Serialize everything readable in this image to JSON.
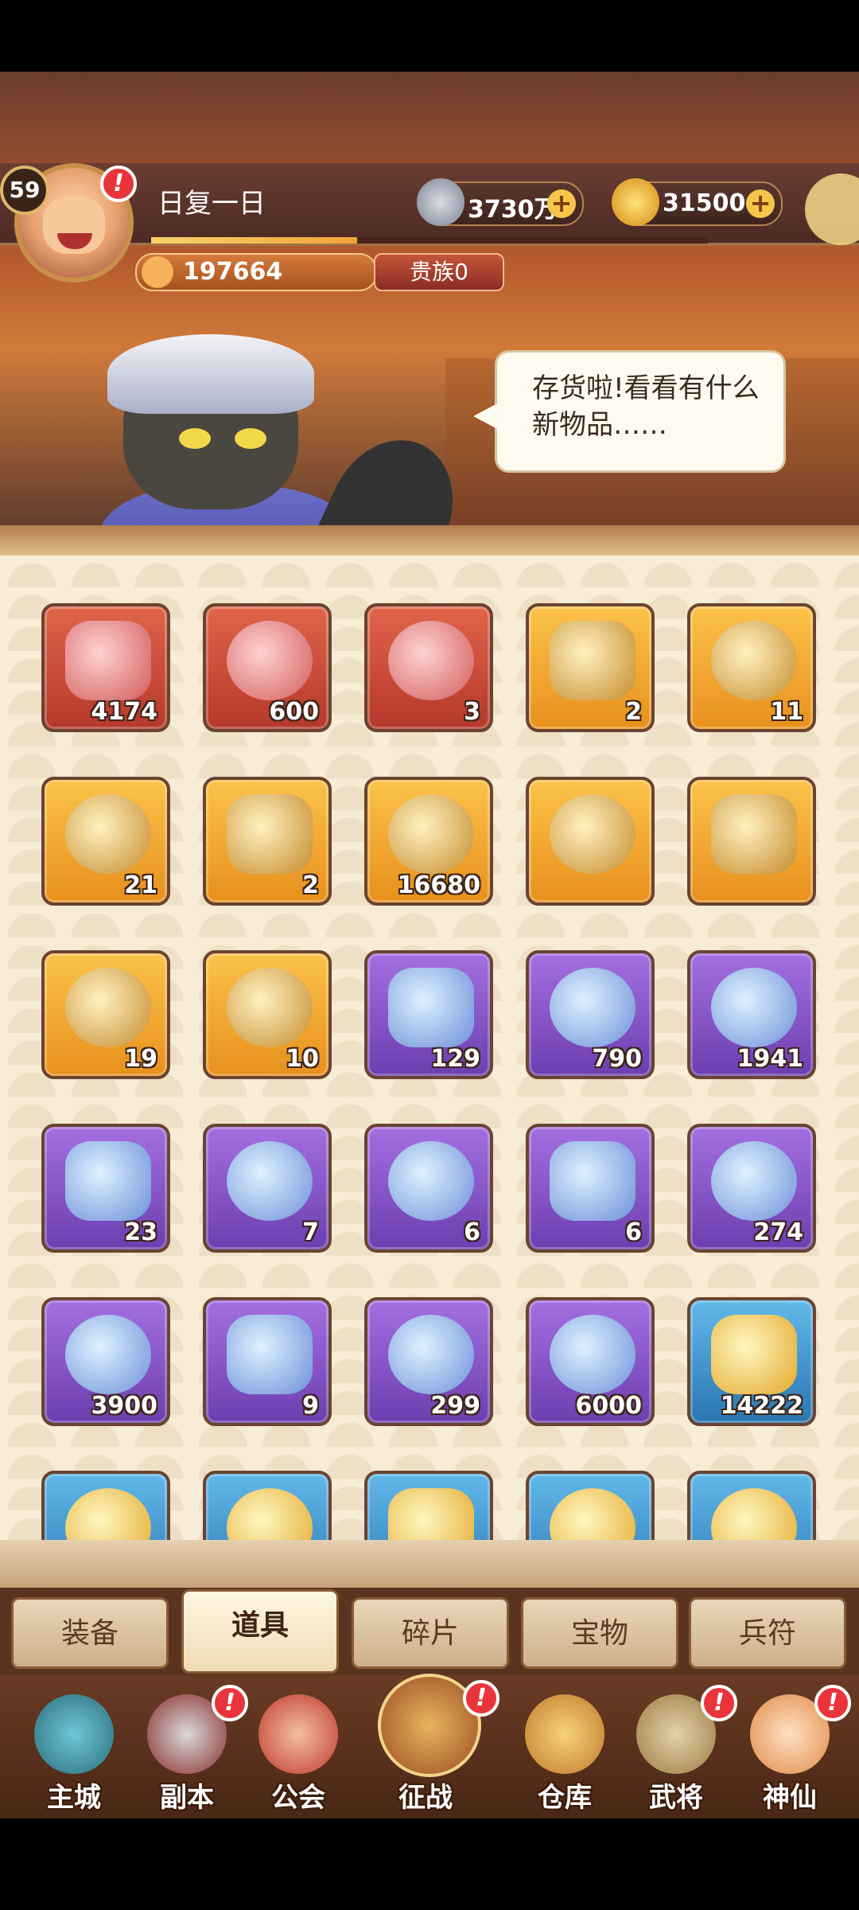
{
  "header": {
    "level": "59",
    "nickname": "日复一日",
    "power": "197664",
    "noble": "贵族0",
    "progress": 0.37,
    "alert_badge": "!",
    "speech": "存货啦!看看有什么新物品……",
    "currencies": [
      {
        "name": "silver-coin",
        "value": "3730万",
        "plus": "+"
      },
      {
        "name": "gold-ingot",
        "value": "31500",
        "plus": "+"
      }
    ]
  },
  "inventory": {
    "items": [
      {
        "name": "pink-crystal",
        "count": "4174",
        "rarity": "red"
      },
      {
        "name": "dark-crystal",
        "count": "600",
        "rarity": "red"
      },
      {
        "name": "jade-chest",
        "count": "3",
        "rarity": "red"
      },
      {
        "name": "bronze-beast",
        "count": "2",
        "rarity": "gold"
      },
      {
        "name": "rune-stone",
        "count": "11",
        "rarity": "gold"
      },
      {
        "name": "general-scroll",
        "count": "21",
        "rarity": "gold"
      },
      {
        "name": "white-lotus",
        "count": "2",
        "rarity": "gold"
      },
      {
        "name": "ore-stone",
        "count": "16680",
        "rarity": "gold"
      },
      {
        "name": "silver-bag",
        "count": "",
        "rarity": "gold"
      },
      {
        "name": "gem-gift-box",
        "count": "",
        "rarity": "gold"
      },
      {
        "name": "phoenix-orb",
        "count": "19",
        "rarity": "gold"
      },
      {
        "name": "flame-orb",
        "count": "10",
        "rarity": "gold"
      },
      {
        "name": "leaf-orb",
        "count": "129",
        "rarity": "purple"
      },
      {
        "name": "scroll",
        "count": "790",
        "rarity": "purple"
      },
      {
        "name": "blue-flame-orb",
        "count": "1941",
        "rarity": "purple"
      },
      {
        "name": "lotus",
        "count": "23",
        "rarity": "purple"
      },
      {
        "name": "gold-ticket",
        "count": "7",
        "rarity": "purple"
      },
      {
        "name": "silver-ingots",
        "count": "6",
        "rarity": "purple"
      },
      {
        "name": "gem-box",
        "count": "6",
        "rarity": "purple"
      },
      {
        "name": "gold-stone",
        "count": "274",
        "rarity": "purple"
      },
      {
        "name": "purple-gem",
        "count": "3900",
        "rarity": "purple"
      },
      {
        "name": "badge",
        "count": "9",
        "rarity": "purple"
      },
      {
        "name": "wooden-token",
        "count": "299",
        "rarity": "purple"
      },
      {
        "name": "gold-coin",
        "count": "6000",
        "rarity": "purple"
      },
      {
        "name": "purple-flame",
        "count": "14222",
        "rarity": "blue"
      },
      {
        "name": "coin-a",
        "count": "",
        "rarity": "blue"
      },
      {
        "name": "coin-b",
        "count": "",
        "rarity": "blue"
      },
      {
        "name": "star-badge",
        "count": "",
        "rarity": "blue"
      },
      {
        "name": "coin-c",
        "count": "",
        "rarity": "blue"
      },
      {
        "name": "purple-crystal",
        "count": "",
        "rarity": "blue"
      }
    ]
  },
  "tabs": [
    "装备",
    "道具",
    "碎片",
    "宝物",
    "兵符"
  ],
  "active_tab": "道具",
  "nav": [
    {
      "label": "主城",
      "alert": false
    },
    {
      "label": "副本",
      "alert": true
    },
    {
      "label": "公会",
      "alert": false
    },
    {
      "label": "征战",
      "alert": true
    },
    {
      "label": "仓库",
      "alert": false
    },
    {
      "label": "武将",
      "alert": true
    },
    {
      "label": "神仙",
      "alert": true
    }
  ],
  "colors": {
    "red": "#e0654a",
    "gold": "#fbc24a",
    "purple": "#a46fe0",
    "blue": "#62b8ea"
  }
}
